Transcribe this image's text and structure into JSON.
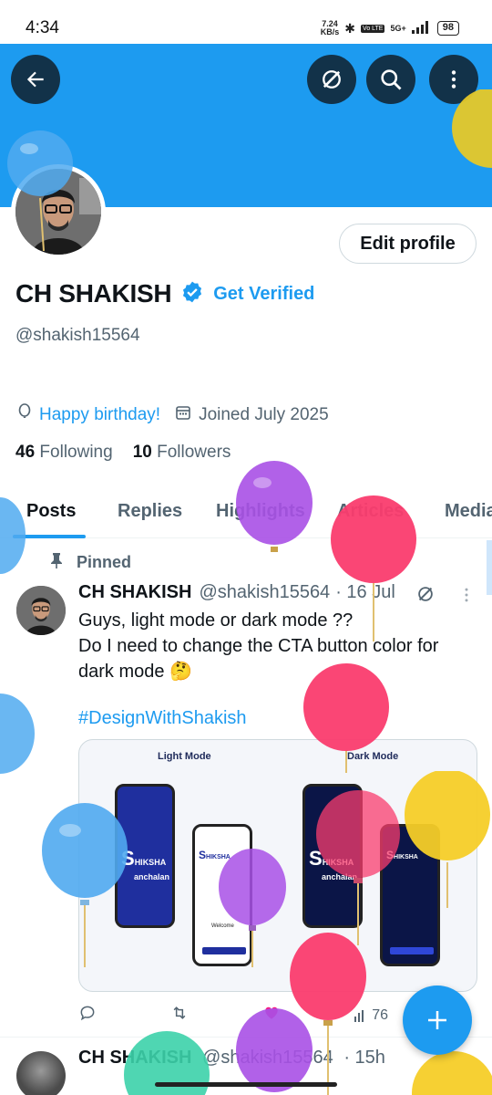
{
  "status_bar": {
    "time": "4:34",
    "net_speed_value": "7.24",
    "net_speed_unit": "KB/s",
    "network": "5G+",
    "battery": "98"
  },
  "toolbar": {
    "back_icon": "arrow-left-icon",
    "grok_icon": "grok-icon",
    "search_icon": "search-icon",
    "more_icon": "more-vertical-icon"
  },
  "profile": {
    "display_name": "CH SHAKISH",
    "get_verified_label": "Get Verified",
    "handle": "@shakish15564",
    "edit_profile_label": "Edit profile",
    "birthday_text": "Happy birthday!",
    "joined_text": "Joined July 2025",
    "following_count": "46",
    "following_label": "Following",
    "followers_count": "10",
    "followers_label": "Followers"
  },
  "tabs": [
    {
      "label": "Posts",
      "active": true
    },
    {
      "label": "Replies",
      "active": false
    },
    {
      "label": "Highlights",
      "active": false
    },
    {
      "label": "Articles",
      "active": false
    },
    {
      "label": "Media",
      "active": false
    }
  ],
  "pinned_post": {
    "pinned_label": "Pinned",
    "author_name": "CH SHAKISH",
    "author_handle": "@shakish15564",
    "date": "· 16 Jul",
    "text_lines": [
      "Guys, light mode or dark mode ??",
      "Do I need to change the CTA button color for",
      "dark mode 🤔"
    ],
    "hashtag": "#DesignWithShakish",
    "media": {
      "light_label": "Light Mode",
      "dark_label": "Dark Mode",
      "brand_line1": "HIKSHA",
      "brand_line2": "anchalan",
      "brand_letter": "S",
      "welcome_text": "Welcome"
    },
    "views": "76"
  },
  "second_post": {
    "author_name": "CH SHAKISH",
    "author_handle": "@shakish15564",
    "time": "· 15h"
  },
  "colors": {
    "accent": "#1d9bf0",
    "banner": "#1d9bf0",
    "text_primary": "#0f1419",
    "text_secondary": "#536471",
    "verified_badge": "#1d9bf0"
  }
}
